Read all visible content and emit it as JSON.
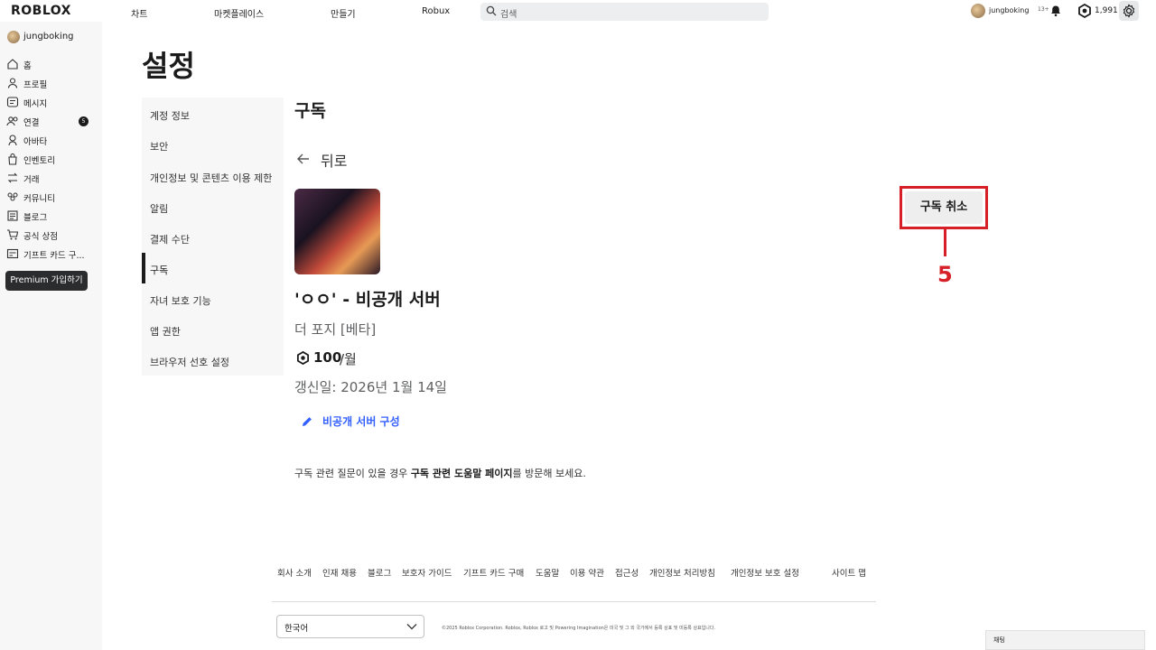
{
  "app": {
    "logo": "ROBLOX"
  },
  "topnav": {
    "links": [
      "차트",
      "마켓플레이스",
      "만들기",
      "Robux"
    ]
  },
  "search": {
    "placeholder": "검색"
  },
  "header_user": {
    "name": "jungboking",
    "age": "13+"
  },
  "robux": {
    "amount": "1,991"
  },
  "sidebar": {
    "username": "jungboking",
    "items": [
      {
        "label": "홈",
        "icon": "home-icon"
      },
      {
        "label": "프로필",
        "icon": "profile-icon"
      },
      {
        "label": "메시지",
        "icon": "message-icon"
      },
      {
        "label": "연결",
        "icon": "friends-icon",
        "badge": "5"
      },
      {
        "label": "아바타",
        "icon": "avatar-icon"
      },
      {
        "label": "인벤토리",
        "icon": "inventory-icon"
      },
      {
        "label": "거래",
        "icon": "trade-icon"
      },
      {
        "label": "커뮤니티",
        "icon": "community-icon"
      },
      {
        "label": "블로그",
        "icon": "blog-icon"
      },
      {
        "label": "공식 상점",
        "icon": "cart-icon"
      },
      {
        "label": "기프트 카드 구...",
        "icon": "gift-card-icon"
      }
    ],
    "premium_label": "Premium 가입하기"
  },
  "page": {
    "title": "설정"
  },
  "settings_nav": {
    "items": [
      "계정 정보",
      "보안",
      "개인정보 및 콘텐츠 이용 제한",
      "알림",
      "결제 수단",
      "구독",
      "자녀 보호 기능",
      "앱 권한",
      "브라우저 선호 설정"
    ],
    "active": "구독"
  },
  "subscription": {
    "section_title": "구독",
    "back_label": "뒤로",
    "server_name": "'ㅇㅇ' - 비공개 서버",
    "game_name": "더 포지 [베타]",
    "price_amount": "100",
    "price_period": "/월",
    "renewal": "갱신일: 2026년 1월 14일",
    "configure_label": "비공개 서버 구성",
    "cancel_label": "구독 취소",
    "callout_number": "5",
    "help_prefix": "구독 관련 질문이 있을 경우 ",
    "help_link": "구독 관련 도움말 페이지",
    "help_suffix": "를 방문해 보세요."
  },
  "footer": {
    "links": [
      "회사 소개",
      "인재 채용",
      "블로그",
      "보호자 가이드",
      "기프트 카드 구매",
      "도움말",
      "이용 약관",
      "접근성",
      "개인정보 처리방침",
      "개인정보 보호 설정",
      "사이트 맵"
    ],
    "language": "한국어",
    "copyright": "©2025 Roblox Corporation. Roblox, Roblox 로고 및 Powering Imagination은 미국 및 그 외 국가에서 등록 상표 및 미등록 상표입니다."
  },
  "chat": {
    "label": "채팅"
  },
  "colors": {
    "accent_link": "#335fff",
    "annotation_red": "#d61f26",
    "premium_bg": "#2b2c2e"
  }
}
